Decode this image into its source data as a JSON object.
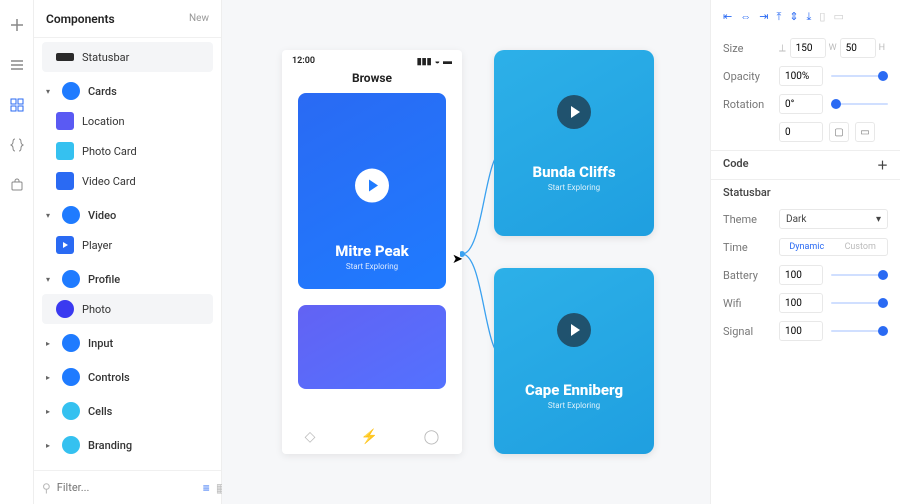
{
  "sidebar": {
    "title": "Components",
    "newLabel": "New",
    "items": [
      {
        "kind": "leaf",
        "icon": "statusbar",
        "label": "Statusbar",
        "selected": true,
        "iconBg": "#2a2a2a",
        "shape": "bar"
      },
      {
        "kind": "cat",
        "open": true,
        "label": "Cards"
      },
      {
        "kind": "leaf",
        "icon": "location",
        "label": "Location",
        "iconBg": "#5a5af3"
      },
      {
        "kind": "leaf",
        "icon": "photo-card",
        "label": "Photo Card",
        "iconBg": "#35c1f0"
      },
      {
        "kind": "leaf",
        "icon": "video-card",
        "label": "Video Card",
        "iconBg": "#2a6af3"
      },
      {
        "kind": "cat",
        "open": true,
        "label": "Video"
      },
      {
        "kind": "leaf",
        "icon": "player",
        "label": "Player",
        "iconBg": "#2a6af3",
        "shape": "play"
      },
      {
        "kind": "cat",
        "open": true,
        "label": "Profile"
      },
      {
        "kind": "leaf",
        "icon": "photo",
        "label": "Photo",
        "selected": true,
        "iconBg": "#3a3af0",
        "shape": "dot"
      },
      {
        "kind": "cat",
        "open": false,
        "label": "Input"
      },
      {
        "kind": "cat",
        "open": false,
        "label": "Controls"
      },
      {
        "kind": "cat",
        "open": false,
        "label": "Cells",
        "color": "#35c1f0"
      },
      {
        "kind": "cat",
        "open": false,
        "label": "Branding",
        "color": "#35c1f0"
      }
    ],
    "filterPlaceholder": "Filter..."
  },
  "canvas": {
    "phone": {
      "time": "12:00",
      "title": "Browse",
      "card": {
        "title": "Mitre Peak",
        "subtitle": "Start Exploring"
      }
    },
    "cards": [
      {
        "title": "Bunda Cliffs",
        "subtitle": "Start Exploring"
      },
      {
        "title": "Cape Enniberg",
        "subtitle": "Start Exploring"
      }
    ]
  },
  "inspector": {
    "size": {
      "label": "Size",
      "w": "150",
      "h": "50"
    },
    "opacity": {
      "label": "Opacity",
      "value": "100%"
    },
    "rotation": {
      "label": "Rotation",
      "value": "0°",
      "extra": "0"
    },
    "codeHeader": "Code",
    "componentName": "Statusbar",
    "theme": {
      "label": "Theme",
      "value": "Dark"
    },
    "time": {
      "label": "Time",
      "options": [
        "Dynamic",
        "Custom"
      ],
      "selected": 0
    },
    "battery": {
      "label": "Battery",
      "value": "100"
    },
    "wifi": {
      "label": "Wifi",
      "value": "100"
    },
    "signal": {
      "label": "Signal",
      "value": "100"
    }
  }
}
